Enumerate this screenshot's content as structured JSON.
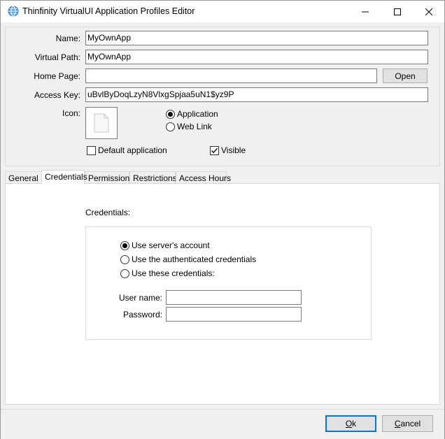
{
  "window": {
    "title": "Thinfinity VirtualUI Application Profiles Editor",
    "minimize_icon": "minimize-icon",
    "maximize_icon": "maximize-icon",
    "close_icon": "close-icon"
  },
  "form": {
    "name_label": "Name:",
    "name_value": "MyOwnApp",
    "virtual_path_label": "Virtual Path:",
    "virtual_path_value": "MyOwnApp",
    "home_page_label": "Home Page:",
    "home_page_value": "",
    "open_button": "Open",
    "access_key_label": "Access Key:",
    "access_key_value": "uBvlByDoqLzyN8VlxgSpjaa5uN1$yz9P",
    "icon_label": "Icon:",
    "type_application": "Application",
    "type_web_link": "Web Link",
    "type_selected": "Application",
    "default_application_label": "Default application",
    "default_application_checked": false,
    "visible_label": "Visible",
    "visible_checked": true
  },
  "tabs": [
    {
      "label": "General",
      "active": false
    },
    {
      "label": "Credentials",
      "active": true
    },
    {
      "label": "Permissions",
      "active": false
    },
    {
      "label": "Restrictions",
      "active": false
    },
    {
      "label": "Access Hours",
      "active": false
    }
  ],
  "credentials": {
    "section_label": "Credentials:",
    "options": [
      {
        "label": "Use server's account",
        "selected": true
      },
      {
        "label": "Use the authenticated credentials",
        "selected": false
      },
      {
        "label": "Use these credentials:",
        "selected": false
      }
    ],
    "username_label": "User name:",
    "username_value": "",
    "password_label": "Password:",
    "password_value": ""
  },
  "footer": {
    "ok_prefix": "O",
    "ok_rest": "k",
    "cancel_prefix": "C",
    "cancel_rest": "ancel"
  }
}
